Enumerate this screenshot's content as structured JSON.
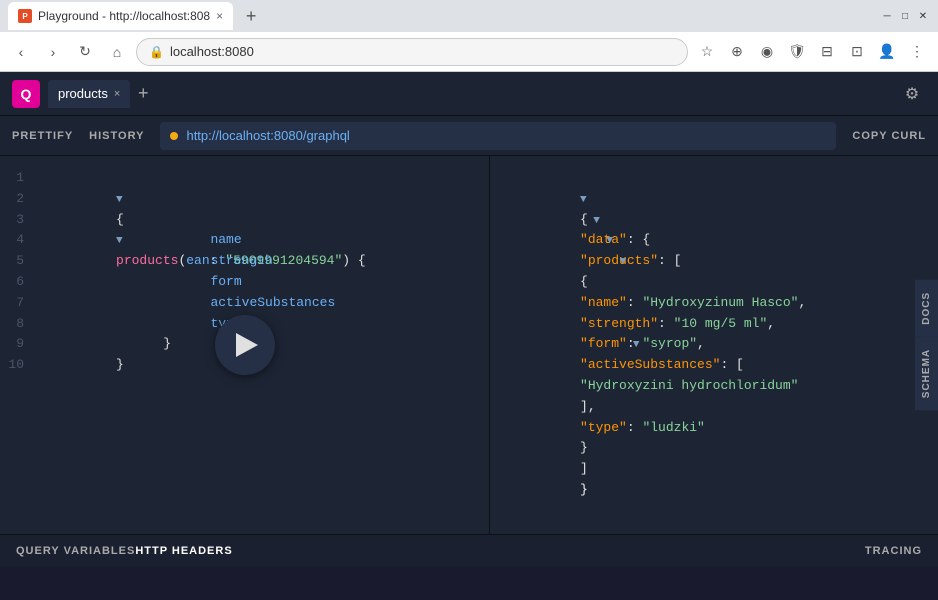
{
  "browser": {
    "title": "Playground - http://localhost:808",
    "tab_label": "Playground - http://localhost:808",
    "new_tab_label": "+",
    "address": "localhost:8080",
    "favicon_letter": "Q"
  },
  "playground": {
    "logo_letter": "Q",
    "tab_name": "products",
    "tab_close": "×",
    "add_tab": "+",
    "settings_icon": "⚙",
    "toolbar": {
      "prettify": "PRETTIFY",
      "history": "HISTORY",
      "url": "http://localhost:8080/graphql",
      "copy_curl": "COPY CURL"
    },
    "query": {
      "lines": [
        "1",
        "2",
        "3",
        "4",
        "5",
        "6",
        "7",
        "8",
        "9",
        "10"
      ],
      "code": [
        "{",
        "  products(ean: \"5909991204594\") {",
        "    name",
        "    strength",
        "    form",
        "    activeSubstances",
        "    type",
        "  }",
        "}",
        ""
      ]
    },
    "response": {
      "lines": [
        "{",
        "  \"data\": {",
        "    \"products\": [",
        "      {",
        "        \"name\": \"Hydroxyzinum Hasco\",",
        "        \"strength\": \"10 mg/5 ml\",",
        "        \"form\": \"syrop\",",
        "        \"activeSubstances\": [",
        "          \"Hydroxyzini hydrochloridum\"",
        "        ],",
        "        \"type\": \"ludzki\"",
        "      }",
        "    ]",
        "  }",
        "}"
      ]
    },
    "side_tabs": {
      "docs": "DOCS",
      "schema": "SCHEMA"
    },
    "bottom": {
      "query_variables": "QUERY VARIABLES",
      "http_headers": "HTTP HEADERS",
      "tracing": "TRACING"
    }
  }
}
